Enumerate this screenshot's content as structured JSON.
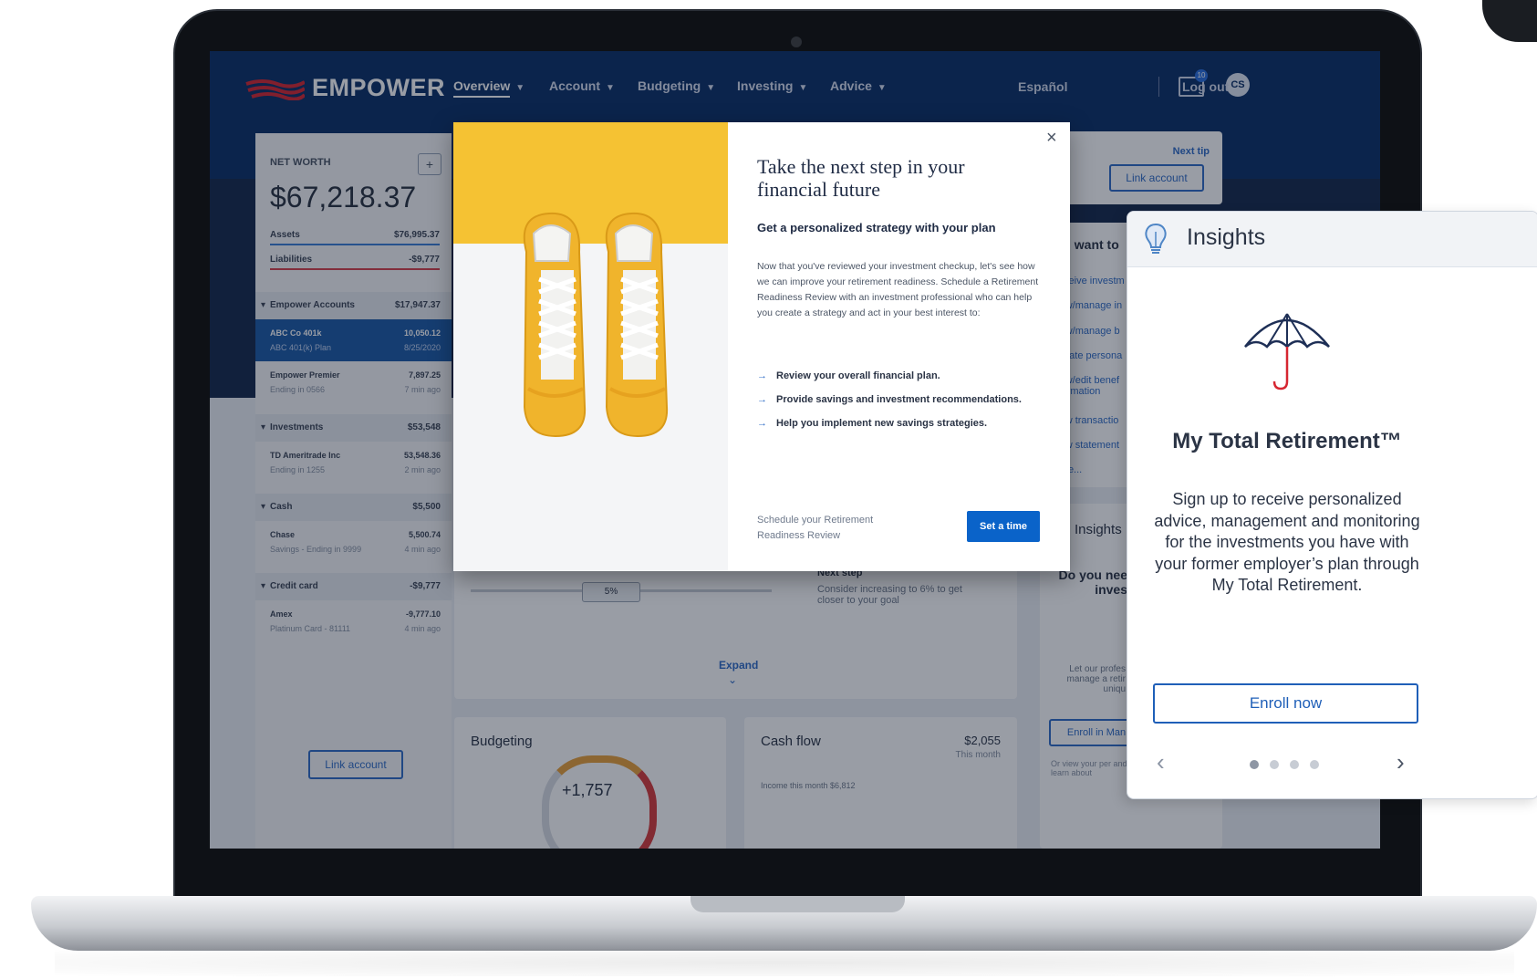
{
  "app": {
    "logo_text": "EMPOWER",
    "nav": [
      {
        "label": "Overview"
      },
      {
        "label": "Account"
      },
      {
        "label": "Budgeting"
      },
      {
        "label": "Investing"
      },
      {
        "label": "Advice"
      }
    ],
    "language_link": "Español",
    "mail_badge": "10",
    "avatar_initials": "CS",
    "logout_label": "Log out"
  },
  "net_worth": {
    "title": "NET WORTH",
    "add_label": "+",
    "value": "$67,218.37",
    "assets_label": "Assets",
    "assets_value": "$76,995.37",
    "liabilities_label": "Liabilities",
    "liabilities_value": "-$9,777",
    "groups": [
      {
        "name": "Empower Accounts",
        "total": "$17,947.37"
      },
      {
        "name": "Investments",
        "total": "$53,548"
      },
      {
        "name": "Cash",
        "total": "$5,500"
      },
      {
        "name": "Credit card",
        "total": "-$9,777"
      }
    ],
    "accounts": [
      {
        "name": "ABC Co 401k",
        "detail": "ABC 401(k) Plan",
        "value": "10,050.12",
        "time": "8/25/2020"
      },
      {
        "name": "Empower Premier",
        "detail": "Ending in 0566",
        "value": "7,897.25",
        "time": "7 min ago"
      },
      {
        "name": "TD Ameritrade Inc",
        "detail": "Ending in 1255",
        "value": "53,548.36",
        "time": "2 min ago"
      },
      {
        "name": "Chase",
        "detail": "Savings - Ending in 9999",
        "value": "5,500.74",
        "time": "4 min ago"
      },
      {
        "name": "Amex",
        "detail": "Platinum Card - 81111",
        "value": "-9,777.10",
        "time": "4 min ago"
      }
    ],
    "link_account_label": "Link account"
  },
  "top_card": {
    "next_tip": "Next tip",
    "link_account_label": "Link account"
  },
  "i_want_to": {
    "title": "I want to",
    "links": [
      "Receive investm",
      "View/manage in",
      "View/manage b",
      "Update persona",
      "View/edit benef information",
      "View transactio",
      "View statement",
      "More..."
    ]
  },
  "savings_card": {
    "slider_value": "5%",
    "next_step_label": "Next step",
    "next_step_text": "Consider increasing to 6% to get closer to your goal",
    "expand_label": "Expand"
  },
  "side_insights": {
    "title": "Insights",
    "question": "Do you nee inves",
    "blurb": "Let our profes manage a retir uniqu",
    "enroll_label": "Enroll in Man",
    "footer": "Or view your per and learn about"
  },
  "budgeting": {
    "title": "Budgeting",
    "gauge_value": "+1,757"
  },
  "cash_flow": {
    "title": "Cash flow",
    "amount": "$2,055",
    "period": "This month",
    "income": "Income this month $6,812"
  },
  "modal": {
    "close_label": "×",
    "title": "Take the next step in your financial future",
    "subtitle": "Get a personalized strategy with your plan",
    "body": "Now that you've reviewed your investment checkup, let's see how we can improve your retirement readiness. Schedule a Retirement Readiness Review with an investment professional who can help you create a strategy and act in your best interest to:",
    "list": [
      "Review your overall financial plan.",
      "Provide savings and investment recommendations.",
      "Help you implement new savings strategies."
    ],
    "footer_text": "Schedule your Retirement Readiness Review",
    "button_label": "Set a time"
  },
  "insights_panel": {
    "title": "Insights",
    "card_title": "My Total Retirement™",
    "description": "Sign up to receive personalized advice, management and monitoring for the investments you have with your former employer’s plan through My Total Retirement.",
    "enroll_label": "Enroll now",
    "prev_label": "‹",
    "next_label": "›",
    "dots": 4,
    "active_dot": 0
  },
  "colors": {
    "navy": "#0b2f66",
    "brand_red": "#d62631",
    "accent_blue": "#0a63c9",
    "shoe_yellow": "#f5c233"
  }
}
